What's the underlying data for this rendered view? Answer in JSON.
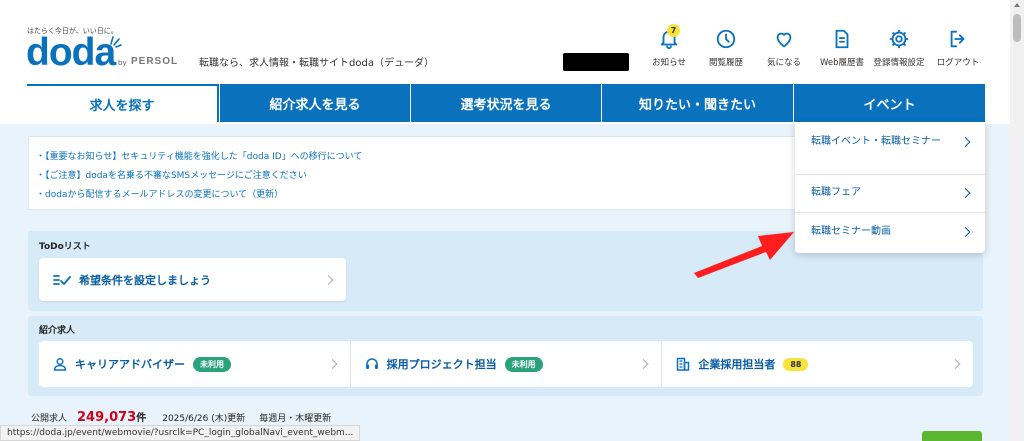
{
  "header": {
    "tagline": "はたらく今日が、いい日に。",
    "logo_text": "doda",
    "by_text": "by",
    "persol_text": "PERSOL",
    "site_description": "転職なら、求人情報・転職サイトdoda（デューダ）",
    "nav": [
      {
        "label": "お知らせ",
        "icon": "bell-icon",
        "badge": "7"
      },
      {
        "label": "閲覧履歴",
        "icon": "clock-icon"
      },
      {
        "label": "気になる",
        "icon": "heart-icon"
      },
      {
        "label": "Web履歴書",
        "icon": "document-icon"
      },
      {
        "label": "登録情報設定",
        "icon": "gear-icon"
      },
      {
        "label": "ログアウト",
        "icon": "logout-icon"
      }
    ]
  },
  "main_nav": {
    "tabs": [
      {
        "label": "求人を探す",
        "active": true
      },
      {
        "label": "紹介求人を見る"
      },
      {
        "label": "選考状況を見る"
      },
      {
        "label": "知りたい・聞きたい"
      },
      {
        "label": "イベント"
      }
    ]
  },
  "notices": [
    "・【重要なお知らせ】セキュリティ機能を強化した「doda ID」への移行について",
    "・【ご注意】dodaを名乗る不審なSMSメッセージにご注意ください",
    "・dodaから配信するメールアドレスの変更について（更新）"
  ],
  "todo": {
    "title": "ToDoリスト",
    "item": "希望条件を設定しましょう"
  },
  "introduction": {
    "title": "紹介求人",
    "cards": [
      {
        "label": "キャリアアドバイザー",
        "tag": "未利用",
        "icon": "person-icon"
      },
      {
        "label": "採用プロジェクト担当",
        "tag": "未利用",
        "icon": "headset-icon"
      },
      {
        "label": "企業採用担当者",
        "tag": "88",
        "icon": "building-icon"
      }
    ]
  },
  "stats": {
    "label": "公開求人",
    "count": "249,073",
    "unit": "件",
    "updated": "2025/6/26 (木)更新",
    "schedule": "毎週月・木曜更新"
  },
  "event_dropdown": {
    "items": [
      "転職イベント・転職セミナー",
      "転職フェア",
      "転職セミナー動画"
    ]
  },
  "status_url": "https://doda.jp/event/webmovie/?usrclk=PC_login_globalNavi_event_webm...",
  "colors": {
    "brand_blue": "#0a72bd",
    "content_bg": "#e9f3fb",
    "section_bg": "#d7eaf7",
    "badge_yellow": "#f8e33b",
    "tag_green": "#2aa27c",
    "count_red": "#d0021b",
    "arrow_red": "#ff1e1e"
  }
}
